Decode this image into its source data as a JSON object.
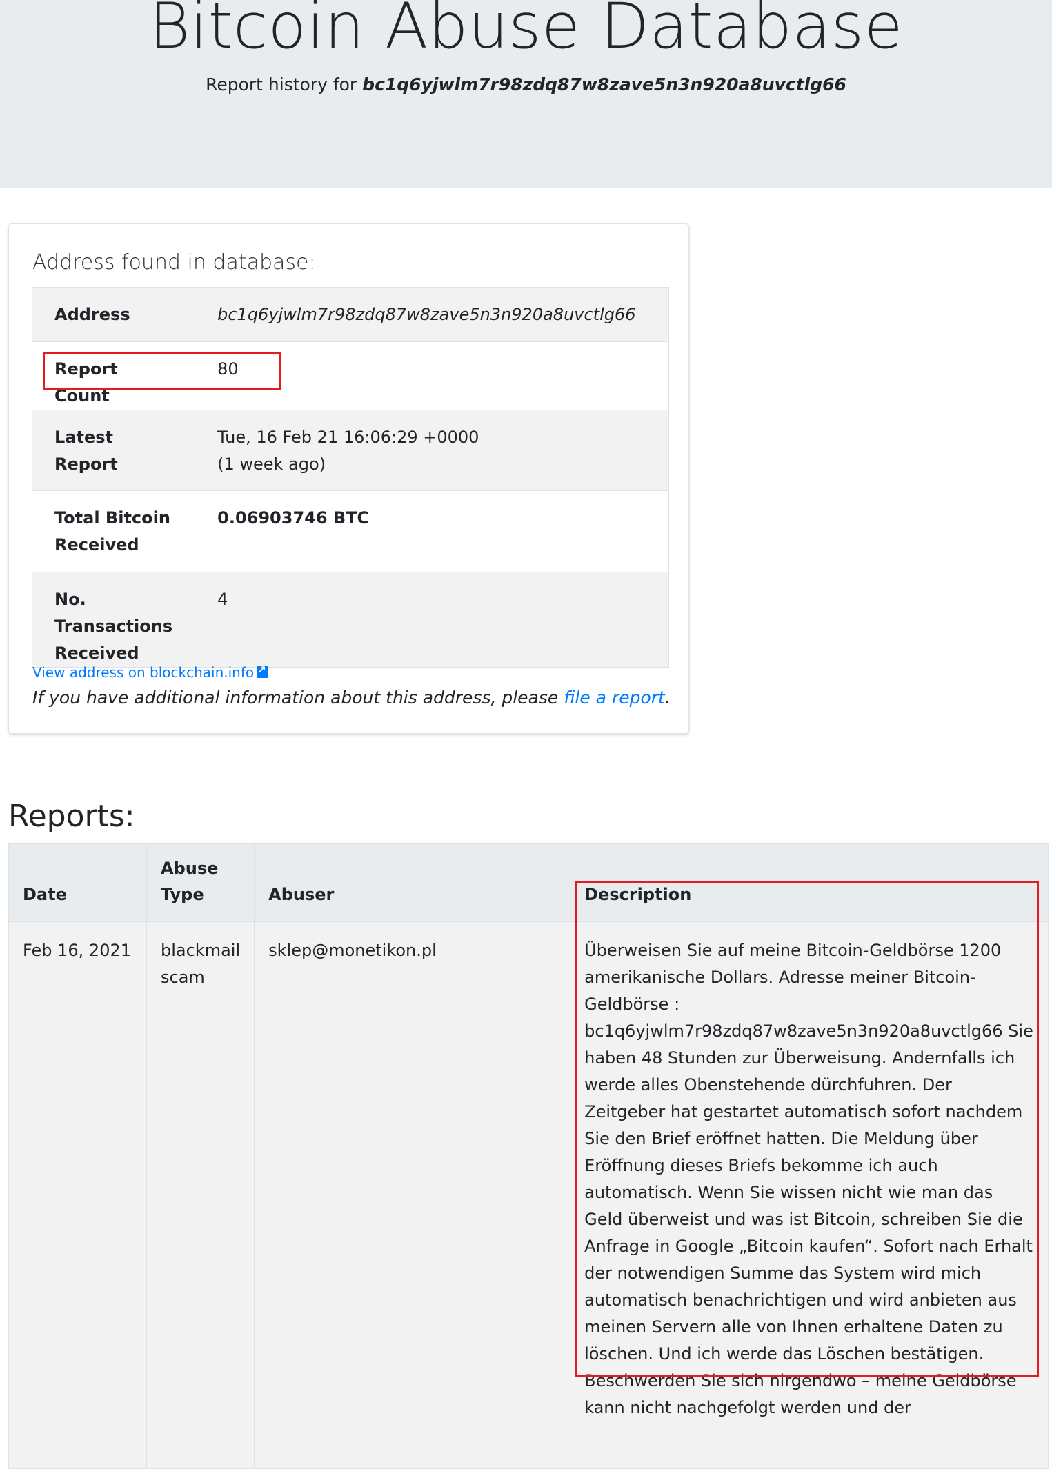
{
  "header": {
    "title": "Bitcoin Abuse Database",
    "subtitle_prefix": "Report history for",
    "address": "bc1q6yjwlm7r98zdq87w8zave5n3n920a8uvctlg66"
  },
  "summary": {
    "heading": "Address found in database:",
    "rows": {
      "address": {
        "label": "Address",
        "value": "bc1q6yjwlm7r98zdq87w8zave5n3n920a8uvctlg66"
      },
      "report_count": {
        "label": "Report Count",
        "value": "80"
      },
      "latest_report": {
        "label": "Latest Report",
        "value": "Tue, 16 Feb 21 16:06:29 +0000",
        "relative": "(1 week ago)"
      },
      "total_received": {
        "label": "Total Bitcoin Received",
        "value": "0.06903746 BTC"
      },
      "tx_received": {
        "label": "No. Transactions Received",
        "value": "4"
      }
    },
    "blockchain_link": "View address on blockchain.info",
    "additional_prefix": "If you have additional information about this address, please",
    "additional_link": "file a report",
    "additional_suffix": "."
  },
  "reports": {
    "heading": "Reports:",
    "columns": {
      "date": "Date",
      "abuse_type": "Abuse Type",
      "abuser": "Abuser",
      "description": "Description"
    },
    "rows": [
      {
        "date": "Feb 16, 2021",
        "abuse_type": "blackmail scam",
        "abuser": "sklep@monetikon.pl",
        "description": "Überweisen Sie auf meine Bitcoin-Geldbörse 1200 amerikanische Dollars. Adresse meiner Bitcoin-Geldbörse : bc1q6yjwlm7r98zdq87w8zave5n3n920a8uvctlg66 Sie haben 48 Stunden zur Überweisung. Andernfalls ich werde alles Obenstehende dürchfuhren. Der Zeitgeber hat gestartet automatisch sofort nachdem Sie den Brief eröffnet hatten. Die Meldung über Eröffnung dieses Briefs bekomme ich auch automatisch. Wenn Sie wissen nicht wie man das Geld überweist und was ist Bitcoin, schreiben Sie die Anfrage in Google „Bitcoin kaufen“. Sofort nach Erhalt der notwendigen Summe das System wird mich automatisch benachrichtigen und wird anbieten aus meinen Servern alle von Ihnen erhaltene Daten zu löschen. Und ich werde das Löschen bestätigen. Beschwerden Sie sich nirgendwo – meine Geldbörse kann nicht nachgefolgt werden und der"
      }
    ]
  }
}
